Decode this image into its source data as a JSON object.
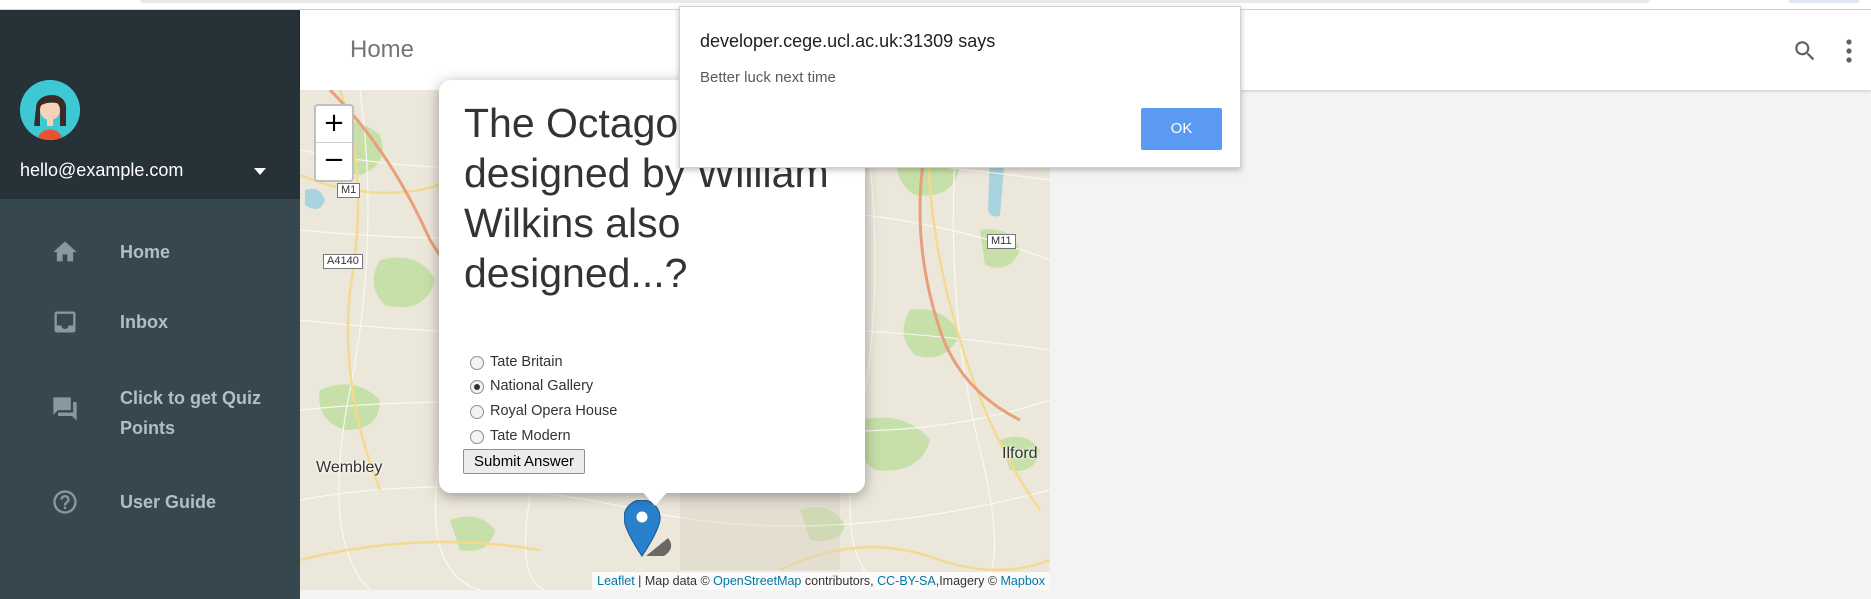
{
  "header": {
    "title": "Home"
  },
  "drawer": {
    "email": "hello@example.com",
    "items": [
      {
        "label": "Home",
        "icon": "home-icon"
      },
      {
        "label": "Inbox",
        "icon": "inbox-icon"
      },
      {
        "label": "Click to get Quiz Points",
        "icon": "chat-icon"
      },
      {
        "label": "User Guide",
        "icon": "help-icon"
      }
    ]
  },
  "map": {
    "zoom_in": "+",
    "zoom_out": "−",
    "labels": {
      "wembley": "Wembley",
      "ilford": "Ilford"
    },
    "roads": {
      "m1": "M1",
      "a4140": "A4140",
      "m11": "M11"
    },
    "attribution": {
      "leaflet": "Leaflet",
      "sep1": " | Map data © ",
      "osm": "OpenStreetMap",
      "sep2": " contributors, ",
      "license": "CC-BY-SA",
      "sep3": ",Imagery © ",
      "mapbox": "Mapbox"
    }
  },
  "quiz": {
    "question": "The Octagon, designed by William Wilkins also designed...?",
    "options": [
      {
        "label": "Tate Britain",
        "selected": false
      },
      {
        "label": "National Gallery",
        "selected": true
      },
      {
        "label": "Royal Opera House",
        "selected": false
      },
      {
        "label": "Tate Modern",
        "selected": false
      }
    ],
    "submit_label": "Submit Answer"
  },
  "alert": {
    "title": "developer.cege.ucl.ac.uk:31309 says",
    "message": "Better luck next time",
    "ok_label": "OK"
  },
  "colors": {
    "drawer_bg": "#37474f",
    "drawer_header_bg": "#263238",
    "ok_button": "#5b9af3",
    "marker": "#2a81cb"
  }
}
